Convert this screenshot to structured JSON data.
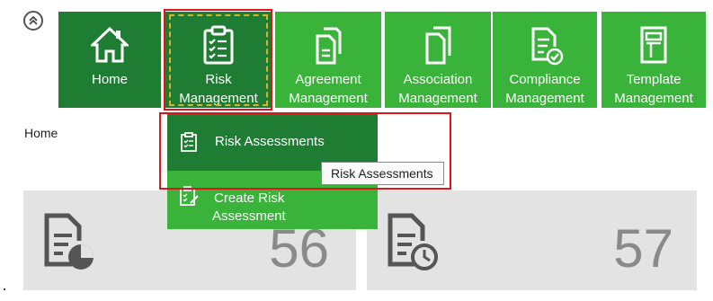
{
  "nav": {
    "collapse_icon": "chevron-double-up-icon",
    "tiles": [
      {
        "id": "home",
        "label": "Home",
        "icon": "home-icon"
      },
      {
        "id": "risk",
        "label_line1": "Risk",
        "label_line2": "Management",
        "icon": "clipboard-checklist-icon"
      },
      {
        "id": "agreement",
        "label_line1": "Agreement",
        "label_line2": "Management",
        "icon": "documents-icon"
      },
      {
        "id": "association",
        "label_line1": "Association",
        "label_line2": "Management",
        "icon": "document-copy-icon"
      },
      {
        "id": "compliance",
        "label_line1": "Compliance",
        "label_line2": "Management",
        "icon": "document-check-icon"
      },
      {
        "id": "template",
        "label_line1": "Template",
        "label_line2": "Management",
        "icon": "template-icon"
      }
    ]
  },
  "breadcrumb": "Home",
  "dropdown": {
    "items": [
      {
        "label": "Risk Assessments",
        "icon": "clipboard-checklist-icon"
      },
      {
        "label_line1": "Create Risk",
        "label_line2": "Assessment",
        "icon": "clipboard-edit-icon"
      }
    ]
  },
  "tooltip": "Risk Assessments",
  "cards": [
    {
      "value": "56",
      "icon": "document-pie-chart-icon"
    },
    {
      "value": "57",
      "icon": "document-clock-icon"
    }
  ],
  "colors": {
    "tile_dark": "#1f7d33",
    "tile_light": "#39b33a",
    "highlight_red": "#e0151b",
    "card_bg": "#e3e3e3"
  }
}
